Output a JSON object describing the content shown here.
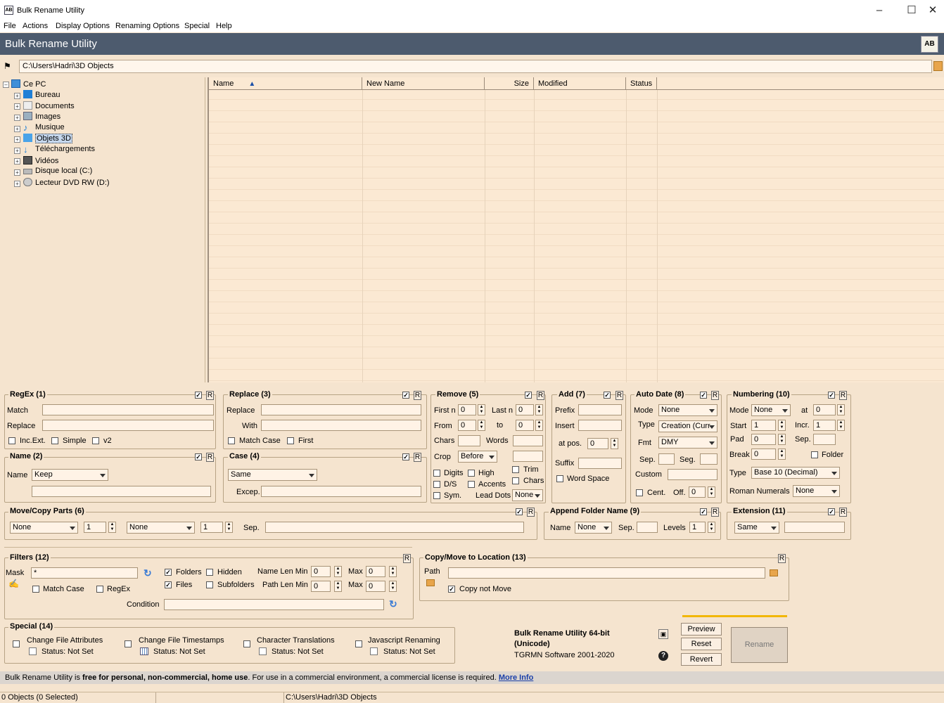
{
  "window": {
    "title": "Bulk Rename Utility"
  },
  "menu": [
    "File",
    "Actions",
    "Display Options",
    "Renaming Options",
    "Special",
    "Help"
  ],
  "banner": {
    "title": "Bulk Rename Utility",
    "logo_text": "AB"
  },
  "path": "C:\\Users\\Hadri\\3D Objects",
  "tree": [
    {
      "label": "Ce PC",
      "icon": "pc-icon"
    },
    {
      "label": "Bureau",
      "icon": "desktop-folder-icon"
    },
    {
      "label": "Documents",
      "icon": "documents-icon"
    },
    {
      "label": "Images",
      "icon": "images-icon"
    },
    {
      "label": "Musique",
      "icon": "music-icon"
    },
    {
      "label": "Objets 3D",
      "icon": "3d-objects-icon",
      "selected": true
    },
    {
      "label": "Téléchargements",
      "icon": "downloads-icon"
    },
    {
      "label": "Vidéos",
      "icon": "videos-icon"
    },
    {
      "label": "Disque local (C:)",
      "icon": "drive-icon"
    },
    {
      "label": "Lecteur DVD RW (D:)",
      "icon": "dvd-icon"
    }
  ],
  "columns": [
    "Name",
    "New Name",
    "Size",
    "Modified",
    "Status"
  ],
  "regex": {
    "title": "RegEx (1)",
    "match": "Match",
    "replace": "Replace",
    "incext": "Inc.Ext.",
    "simple": "Simple",
    "v2": "v2"
  },
  "replace": {
    "title": "Replace (3)",
    "replace": "Replace",
    "with": "With",
    "matchcase": "Match Case",
    "first": "First"
  },
  "remove": {
    "title": "Remove (5)",
    "firstn": "First n",
    "firstn_val": "0",
    "lastn": "Last n",
    "lastn_val": "0",
    "from": "From",
    "from_val": "0",
    "to": "to",
    "to_val": "0",
    "chars": "Chars",
    "words": "Words",
    "crop": "Crop",
    "crop_val": "Before",
    "digits": "Digits",
    "high": "High",
    "trim": "Trim",
    "ds": "D/S",
    "accents": "Accents",
    "chars2": "Chars",
    "sym": "Sym.",
    "leaddots": "Lead Dots",
    "leaddots_val": "None"
  },
  "add": {
    "title": "Add (7)",
    "prefix": "Prefix",
    "insert": "Insert",
    "atpos": "at pos.",
    "atpos_val": "0",
    "suffix": "Suffix",
    "wordspace": "Word Space"
  },
  "autodate": {
    "title": "Auto Date (8)",
    "mode": "Mode",
    "mode_val": "None",
    "type": "Type",
    "type_val": "Creation (Curr",
    "fmt": "Fmt",
    "fmt_val": "DMY",
    "sep": "Sep.",
    "seg": "Seg.",
    "custom": "Custom",
    "cent": "Cent.",
    "off": "Off.",
    "off_val": "0"
  },
  "numbering": {
    "title": "Numbering (10)",
    "mode": "Mode",
    "mode_val": "None",
    "at": "at",
    "at_val": "0",
    "start": "Start",
    "start_val": "1",
    "incr": "Incr.",
    "incr_val": "1",
    "pad": "Pad",
    "pad_val": "0",
    "sep": "Sep.",
    "brk": "Break",
    "brk_val": "0",
    "folder": "Folder",
    "type": "Type",
    "type_val": "Base 10 (Decimal)",
    "roman": "Roman Numerals",
    "roman_val": "None"
  },
  "name": {
    "title": "Name (2)",
    "name": "Name",
    "name_val": "Keep"
  },
  "case": {
    "title": "Case (4)",
    "case_val": "Same",
    "excep": "Excep."
  },
  "movecopy": {
    "title": "Move/Copy Parts (6)",
    "sel1": "None",
    "n1": "1",
    "sel2": "None",
    "n2": "1",
    "sep": "Sep."
  },
  "appendfolder": {
    "title": "Append Folder Name (9)",
    "name": "Name",
    "name_val": "None",
    "sep": "Sep.",
    "levels": "Levels",
    "levels_val": "1"
  },
  "extension": {
    "title": "Extension (11)",
    "val": "Same"
  },
  "filters": {
    "title": "Filters (12)",
    "mask": "Mask",
    "mask_val": "*",
    "folders": "Folders",
    "hidden": "Hidden",
    "files": "Files",
    "subfolders": "Subfolders",
    "namelenmin": "Name Len Min",
    "namelenmin_val": "0",
    "max1": "Max",
    "max1_val": "0",
    "pathlenmin": "Path Len Min",
    "pathlenmin_val": "0",
    "max2": "Max",
    "max2_val": "0",
    "matchcase": "Match Case",
    "regex": "RegEx",
    "condition": "Condition"
  },
  "copymove": {
    "title": "Copy/Move to Location (13)",
    "path": "Path",
    "copynotmove": "Copy not Move"
  },
  "special": {
    "title": "Special (14)",
    "items": [
      {
        "label": "Change File Attributes",
        "status": "Status:",
        "value": "Not Set"
      },
      {
        "label": "Change File Timestamps",
        "status": "Status:",
        "value": "Not Set"
      },
      {
        "label": "Character Translations",
        "status": "Status:",
        "value": "Not Set"
      },
      {
        "label": "Javascript Renaming",
        "status": "Status:",
        "value": "Not Set"
      }
    ]
  },
  "about": {
    "line1": "Bulk Rename Utility 64-bit",
    "line2": "(Unicode)",
    "line3": "TGRMN Software 2001-2020"
  },
  "buttons": {
    "preview": "Preview",
    "reset": "Reset",
    "revert": "Revert",
    "rename": "Rename"
  },
  "infobar": {
    "prefix": "Bulk Rename Utility is ",
    "bold": "free for personal, non-commercial, home use",
    "rest": ". For use in a commercial environment, a commercial license is required. ",
    "link": "More Info"
  },
  "statusbar": {
    "objects": "0 Objects (0 Selected)",
    "path": "C:\\Users\\Hadri\\3D Objects"
  },
  "r_label": "R",
  "colors": {
    "banner": "#4d5b6e",
    "panel": "#f5e4cf",
    "accent": "#f2b705"
  }
}
